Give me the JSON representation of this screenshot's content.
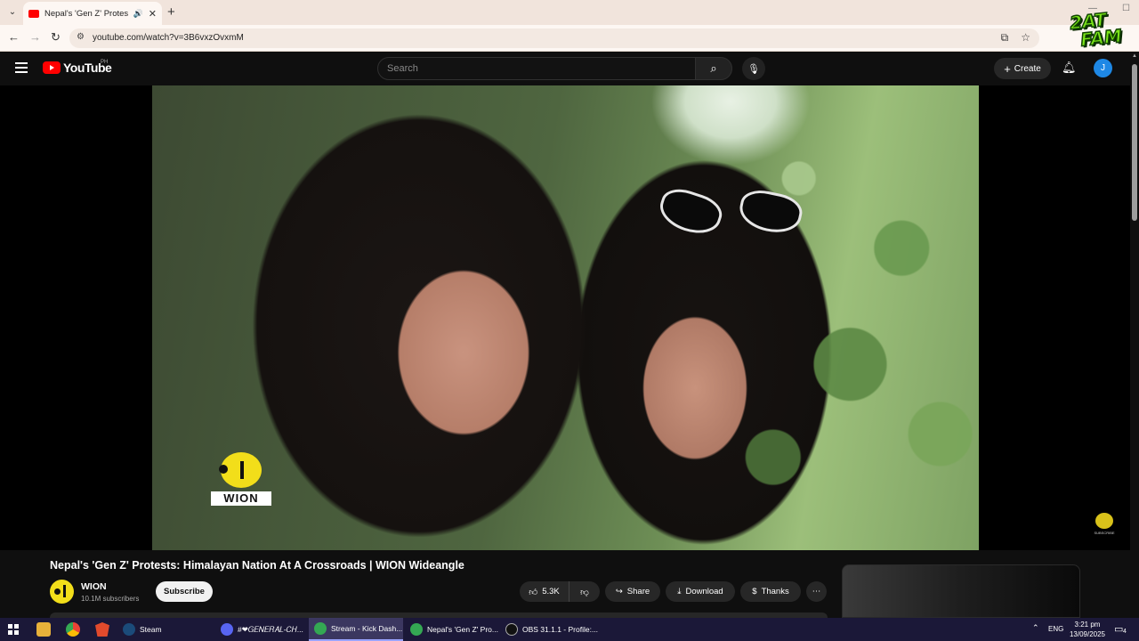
{
  "browser": {
    "tab_title": "Nepal's 'Gen Z' Protests: Hi",
    "url": "youtube.com/watch?v=3B6vxzOvxmM"
  },
  "sticker": {
    "line1": "2AT",
    "line2": "FAM"
  },
  "youtube": {
    "logo_text": "YouTube",
    "country_code": "PH",
    "search_placeholder": "Search",
    "create_label": "Create",
    "avatar_letter": "J"
  },
  "video": {
    "channel_logo_text": "WION",
    "watermark_text": "SUBSCRIBE",
    "title": "Nepal's 'Gen Z' Protests: Himalayan Nation At A Crossroads | WION Wideangle",
    "channel_name": "WION",
    "subscribers": "10.1M subscribers",
    "subscribe_label": "Subscribe",
    "likes": "5.3K",
    "share_label": "Share",
    "download_label": "Download",
    "thanks_label": "Thanks"
  },
  "taskbar": {
    "apps": [
      {
        "label": "Steam",
        "color": "#1b4b7a"
      },
      {
        "label": "#❤𝐺𝐸𝑁𝐸𝑅𝐴𝐿-𝐶𝐻...",
        "color": "#5865f2"
      },
      {
        "label": "Stream - Kick Dash...",
        "color": "#34a853"
      },
      {
        "label": "Nepal's 'Gen Z' Pro...",
        "color": "#34a853"
      },
      {
        "label": "OBS 31.1.1 - Profile:...",
        "color": "#111111"
      }
    ],
    "lang": "ENG",
    "time": "3:21 pm",
    "date": "13/09/2025",
    "notifications": "4"
  }
}
